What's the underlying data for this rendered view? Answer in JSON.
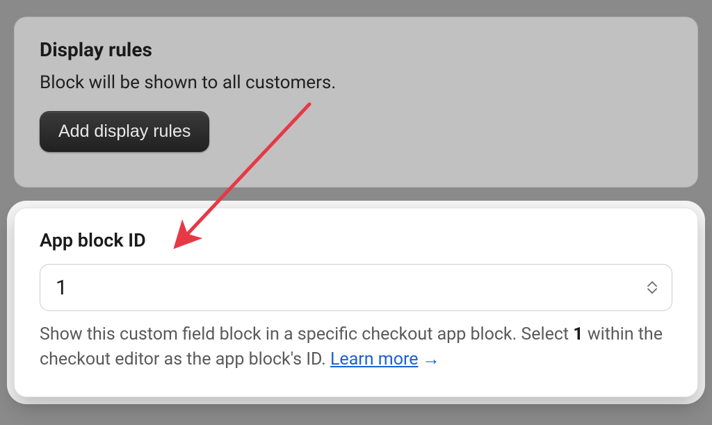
{
  "displayRules": {
    "title": "Display rules",
    "description": "Block will be shown to all customers.",
    "button": "Add display rules"
  },
  "appBlock": {
    "title": "App block ID",
    "selectedValue": "1",
    "helpTextPart1": "Show this custom field block in a specific checkout app block. Select ",
    "helpTextBold": "1",
    "helpTextPart2": " within the checkout editor as the app block's ID. ",
    "learnMore": "Learn more",
    "learnMoreArrow": " →"
  },
  "annotation": {
    "arrowColor": "#e63946"
  }
}
